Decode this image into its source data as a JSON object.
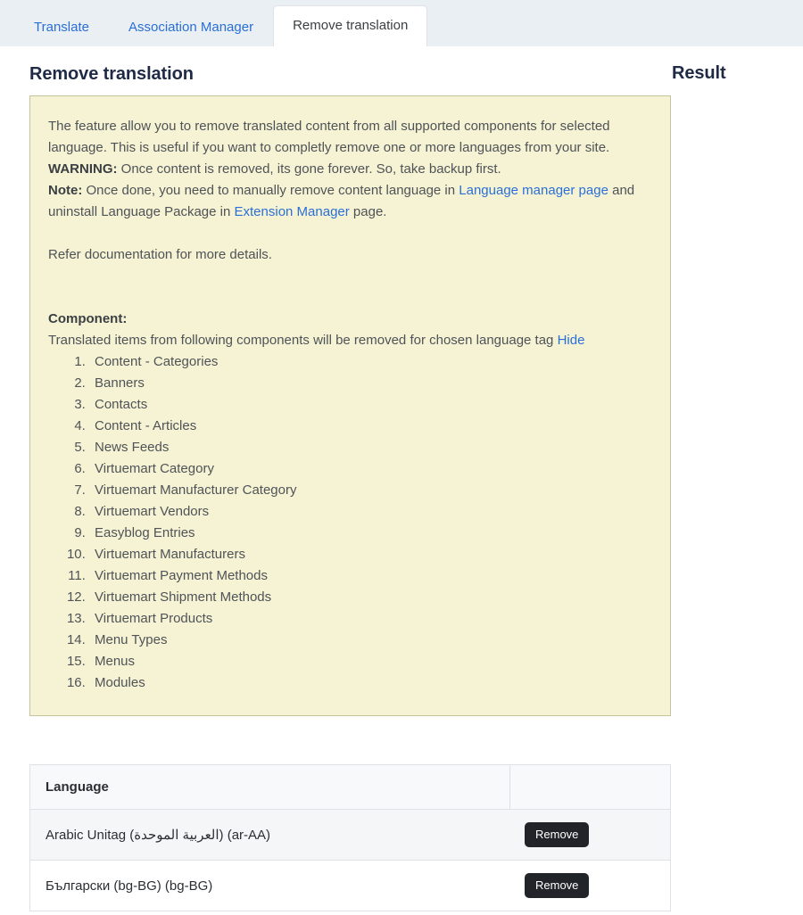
{
  "tabs": [
    {
      "label": "Translate",
      "active": false
    },
    {
      "label": "Association Manager",
      "active": false
    },
    {
      "label": "Remove translation",
      "active": true
    }
  ],
  "page": {
    "title": "Remove translation",
    "result_title": "Result"
  },
  "notice": {
    "paragraph1": "The feature allow you to remove translated content from all supported components for selected language. This is useful if you want to completly remove one or more languages from your site.",
    "warning_label": "WARNING:",
    "warning_text": " Once content is removed, its gone forever. So, take backup first.",
    "note_label": "Note:",
    "note_text_before": " Once done, you need to manually remove content language in ",
    "note_link1": "Language manager page",
    "note_text_middle": " and uninstall Language Package in ",
    "note_link2": "Extension Manager",
    "note_text_after": " page.",
    "refer_text": "Refer documentation for more details.",
    "component_label": "Component:",
    "component_intro": "Translated items from following components will be removed for chosen language tag ",
    "hide_link": "Hide",
    "components": [
      "Content - Categories",
      "Banners",
      "Contacts",
      "Content - Articles",
      "News Feeds",
      "Virtuemart Category",
      "Virtuemart Manufacturer Category",
      "Virtuemart Vendors",
      "Easyblog Entries",
      "Virtuemart Manufacturers",
      "Virtuemart Payment Methods",
      "Virtuemart Shipment Methods",
      "Virtuemart Products",
      "Menu Types",
      "Menus",
      "Modules"
    ]
  },
  "table": {
    "headers": [
      "Language",
      ""
    ],
    "rows": [
      {
        "language": "Arabic Unitag (العربية الموحدة) (ar-AA)",
        "action": "Remove"
      },
      {
        "language": "Български (bg-BG) (bg-BG)",
        "action": "Remove"
      }
    ]
  },
  "colors": {
    "tabbar_bg": "#eaeff4",
    "link": "#2a6fd6",
    "notice_bg": "#f6f3d4",
    "notice_border": "#c3c39c",
    "button_bg": "#212529",
    "heading": "#1f2b45"
  }
}
